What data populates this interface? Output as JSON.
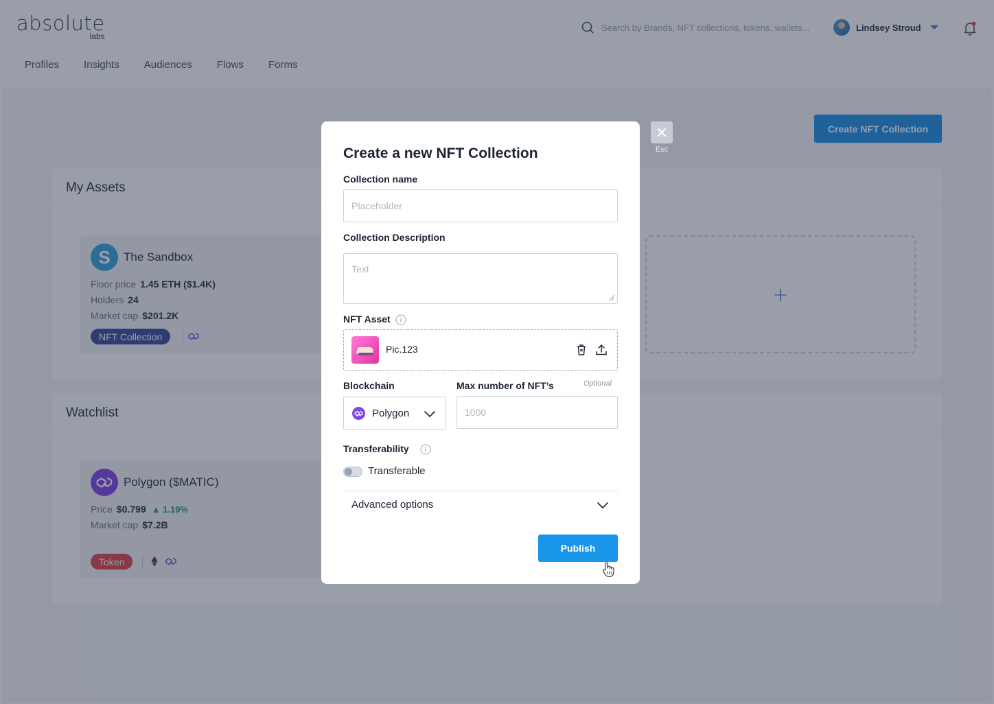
{
  "header": {
    "logo_main": "absolute",
    "logo_sub": "labs",
    "search_placeholder": "Search by Brands, NFT collections, tokens, wallets...",
    "user_name": "Lindsey Stroud"
  },
  "nav": {
    "items": [
      {
        "label": "Profiles"
      },
      {
        "label": "Insights"
      },
      {
        "label": "Audiences"
      },
      {
        "label": "Flows"
      },
      {
        "label": "Forms"
      }
    ]
  },
  "page": {
    "create_button": "Create NFT Collection",
    "my_assets": {
      "title": "My Assets",
      "card": {
        "logo_letter": "S",
        "title": "The Sandbox",
        "floor_label": "Floor price",
        "floor_value": "1.45 ETH ($1.4K)",
        "holders_label": "Holders",
        "holders_value": "24",
        "mcap_label": "Market cap",
        "mcap_value": "$201.2K",
        "badge": "NFT Collection"
      },
      "add_symbol": "+"
    },
    "watchlist": {
      "title": "Watchlist",
      "card": {
        "title": "Polygon ($MATIC)",
        "price_label": "Price",
        "price_value": "$0.799",
        "change": "1.19%",
        "mcap_label": "Market cap",
        "mcap_value": "$7.2B",
        "badge": "Token"
      }
    }
  },
  "modal": {
    "title": "Create a new NFT Collection",
    "close_label": "Esc",
    "collection_name": {
      "label": "Collection name",
      "placeholder": "Placeholder"
    },
    "collection_description": {
      "label": "Collection Description",
      "placeholder": "Text"
    },
    "nft_asset": {
      "label": "NFT Asset",
      "file_name": "Pic.123"
    },
    "blockchain": {
      "label": "Blockchain",
      "selected": "Polygon"
    },
    "max_nfts": {
      "label": "Max number of NFT’s",
      "optional": "Optional",
      "placeholder": "1000"
    },
    "transferability": {
      "label": "Transferability",
      "toggle_label": "Transferable",
      "enabled": false
    },
    "advanced_options": "Advanced options",
    "publish_button": "Publish"
  },
  "colors": {
    "primary": "#1996ea",
    "sandbox_logo": "#3aa4dd",
    "polygon": "#8247e5",
    "nft_badge": "#3c4c9e",
    "token_badge": "#e0464f",
    "positive_change": "#22a06b"
  },
  "icons": [
    "search-icon",
    "bell-icon",
    "chevron-down-icon",
    "close-icon",
    "info-icon",
    "trash-icon",
    "upload-icon",
    "polygon-icon",
    "ethereum-icon",
    "hand-cursor-icon"
  ]
}
